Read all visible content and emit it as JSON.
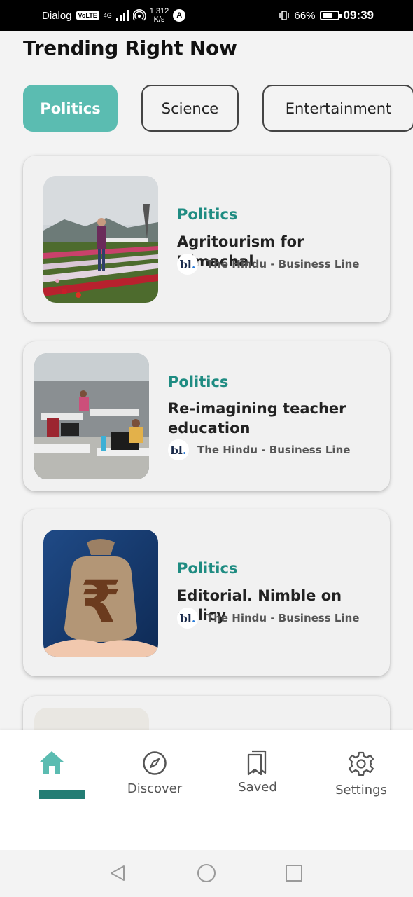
{
  "status_bar": {
    "carrier": "Dialog",
    "volte": "VoLTE",
    "network_type": "4G",
    "speed_value": "312",
    "speed_unit": "K/s",
    "speed_prefix": "1",
    "battery_percent": "66%",
    "time": "09:39"
  },
  "header": {
    "title": "Trending Right Now"
  },
  "categories": [
    {
      "label": "Politics",
      "active": true
    },
    {
      "label": "Science",
      "active": false
    },
    {
      "label": "Entertainment",
      "active": false
    }
  ],
  "articles": [
    {
      "category": "Politics",
      "title": "Agritourism for Himachal",
      "source": "The Hindu - Business Line",
      "source_logo": "bl."
    },
    {
      "category": "Politics",
      "title": "Re-imagining teacher education",
      "source": "The Hindu - Business Line",
      "source_logo": "bl."
    },
    {
      "category": "Politics",
      "title": "Editorial. Nimble on policy",
      "source": "The Hindu - Business Line",
      "source_logo": "bl."
    }
  ],
  "bottom_nav": {
    "items": [
      {
        "label": "",
        "icon": "home-icon",
        "active": true
      },
      {
        "label": "Discover",
        "icon": "compass-icon",
        "active": false
      },
      {
        "label": "Saved",
        "icon": "bookmark-icon",
        "active": false
      },
      {
        "label": "Settings",
        "icon": "gear-icon",
        "active": false
      }
    ]
  },
  "colors": {
    "accent": "#5bbcb1",
    "category_text": "#1f8c82",
    "nav_active": "#237d74"
  }
}
